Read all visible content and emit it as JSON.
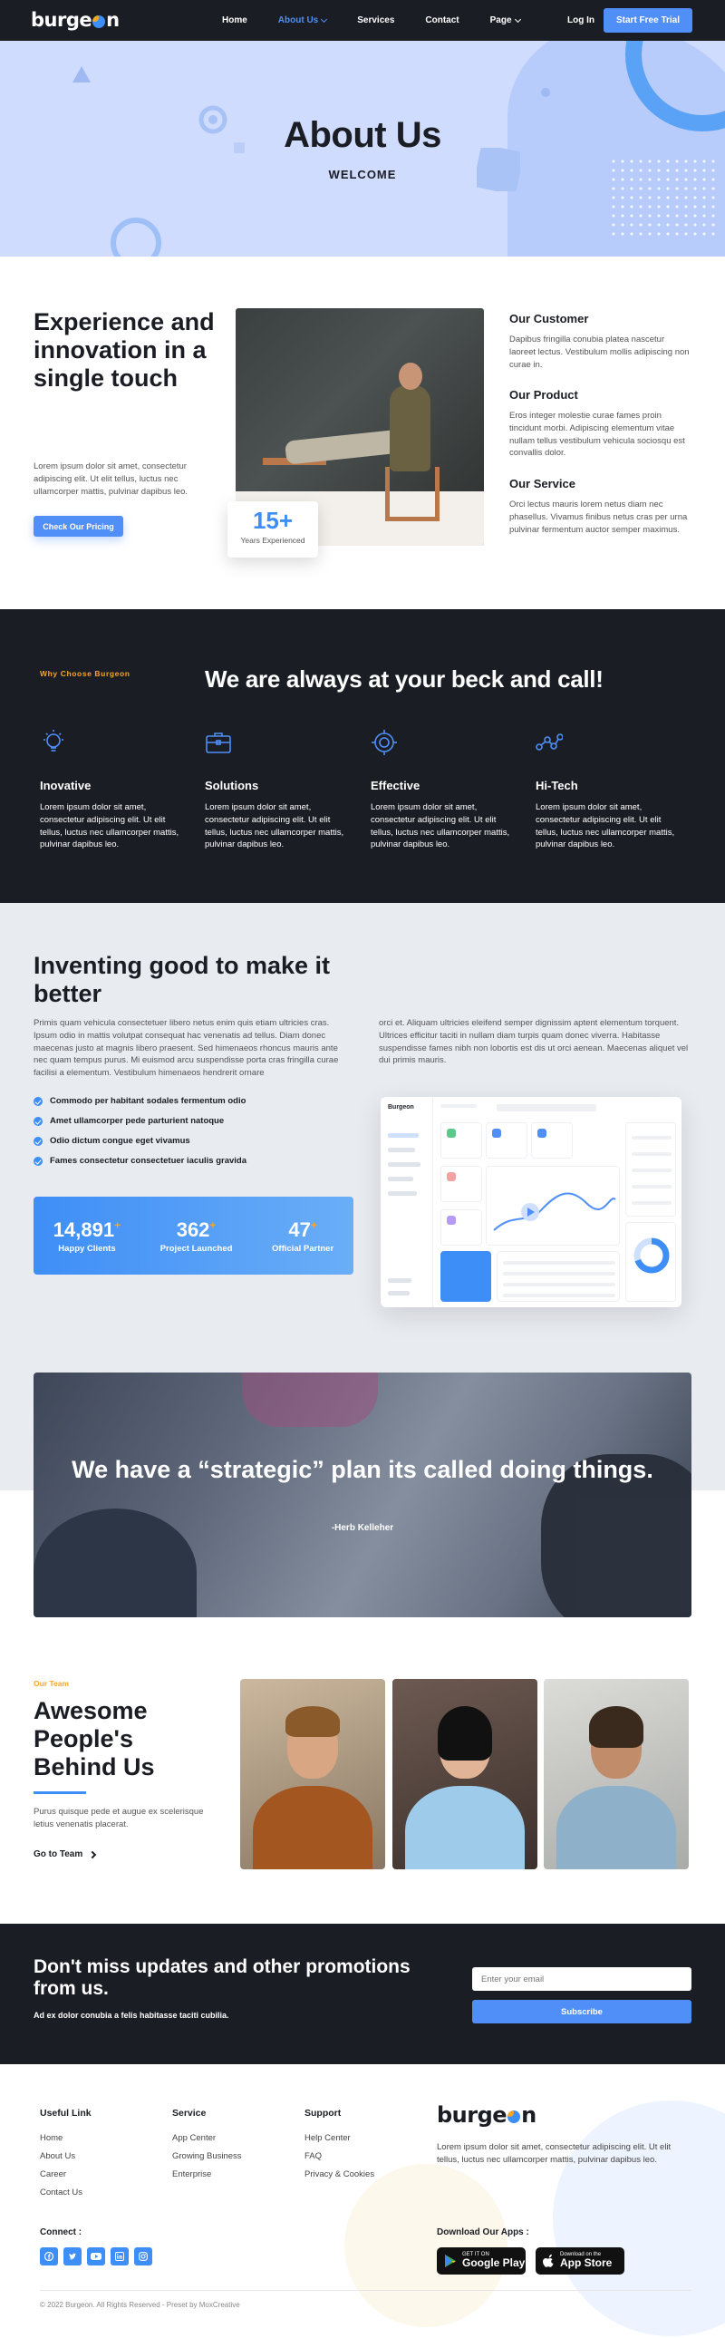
{
  "nav": {
    "brand": "burgeon",
    "links": [
      "Home",
      "About Us",
      "Services",
      "Contact",
      "Page"
    ],
    "login": "Log In",
    "cta": "Start Free Trial"
  },
  "hero": {
    "title": "About Us",
    "subtitle": "WELCOME"
  },
  "about": {
    "heading": "Experience and innovation in a single touch",
    "text": "Lorem ipsum dolor sit amet, consectetur adipiscing elit. Ut elit tellus, luctus nec ullamcorper mattis, pulvinar dapibus leo.",
    "button": "Check Our Pricing",
    "experience_number": "15+",
    "experience_label": "Years Experienced",
    "items": [
      {
        "title": "Our Customer",
        "text": "Dapibus fringilla conubia platea nascetur laoreet lectus. Vestibulum mollis adipiscing non curae in."
      },
      {
        "title": "Our Product",
        "text": "Eros integer molestie curae fames proin tincidunt morbi. Adipiscing elementum vitae nullam tellus vestibulum vehicula sociosqu est convallis dolor."
      },
      {
        "title": "Our Service",
        "text": "Orci lectus mauris lorem netus diam nec phasellus. Vivamus finibus netus cras per urna pulvinar fermentum auctor semper maximus."
      }
    ]
  },
  "why": {
    "tag": "Why Choose Burgeon",
    "heading": "We are always at your beck and call!",
    "features": [
      {
        "icon": "lightbulb-icon",
        "title": "Inovative",
        "text": "Lorem ipsum dolor sit amet, consectetur adipiscing elit. Ut elit tellus, luctus nec ullamcorper mattis, pulvinar dapibus leo."
      },
      {
        "icon": "briefcase-icon",
        "title": "Solutions",
        "text": "Lorem ipsum dolor sit amet, consectetur adipiscing elit. Ut elit tellus, luctus nec ullamcorper mattis, pulvinar dapibus leo."
      },
      {
        "icon": "gear-icon",
        "title": "Effective",
        "text": "Lorem ipsum dolor sit amet, consectetur adipiscing elit. Ut elit tellus, luctus nec ullamcorper mattis, pulvinar dapibus leo."
      },
      {
        "icon": "network-icon",
        "title": "Hi-Tech",
        "text": "Lorem ipsum dolor sit amet, consectetur adipiscing elit. Ut elit tellus, luctus nec ullamcorper mattis, pulvinar dapibus leo."
      }
    ]
  },
  "invent": {
    "heading": "Inventing good to make it better",
    "text_left": "Primis quam vehicula consectetuer libero netus enim quis etiam ultricies cras. Ipsum odio in mattis volutpat consequat hac venenatis ad tellus. Diam donec maecenas justo at magnis libero praesent. Sed himenaeos rhoncus mauris ante nec quam tempus purus. Mi euismod arcu suspendisse porta cras fringilla curae facilisi a elementum. Vestibulum himenaeos hendrerit ornare",
    "text_right": "orci et. Aliquam ultricies eleifend semper dignissim aptent elementum torquent. Ultrices efficitur taciti in nullam diam turpis quam donec viverra. Habitasse suspendisse fames nibh non lobortis est dis ut orci aenean. Maecenas aliquet vel dui primis mauris.",
    "checklist": [
      "Commodo per habitant sodales fermentum odio",
      "Amet ullamcorper pede parturient natoque",
      "Odio dictum congue eget vivamus",
      "Fames consectetur consectetuer iaculis gravida"
    ],
    "stats": [
      {
        "number": "14,891",
        "suffix": "+",
        "label": "Happy Clients"
      },
      {
        "number": "362",
        "suffix": "+",
        "label": "Project Launched"
      },
      {
        "number": "47",
        "suffix": "+",
        "label": "Official Partner"
      }
    ],
    "dashboard": {
      "brand": "Burgeon"
    }
  },
  "quote": {
    "text": "We have a “strategic” plan its called doing things.",
    "author": "-Herb Kelleher"
  },
  "team": {
    "tag": "Our Team",
    "heading": "Awesome People's Behind Us",
    "text": "Purus quisque pede et augue ex scelerisque letius venenatis placerat.",
    "link": "Go to Team"
  },
  "newsletter": {
    "heading": "Don't miss updates and other promotions from us.",
    "text": "Ad ex dolor conubia a felis habitasse taciti cubilia.",
    "placeholder": "Enter your email",
    "button": "Subscribe"
  },
  "footer": {
    "columns": [
      {
        "title": "Useful Link",
        "links": [
          "Home",
          "About Us",
          "Career",
          "Contact Us"
        ]
      },
      {
        "title": "Service",
        "links": [
          "App Center",
          "Growing Business",
          "Enterprise"
        ]
      },
      {
        "title": "Support",
        "links": [
          "Help Center",
          "FAQ",
          "Privacy & Cookies"
        ]
      }
    ],
    "brand": "burgeon",
    "description": "Lorem ipsum dolor sit amet, consectetur adipiscing elit. Ut elit tellus, luctus nec ullamcorper mattis, pulvinar dapibus leo.",
    "connect": "Connect :",
    "socials": [
      "facebook-icon",
      "twitter-icon",
      "youtube-icon",
      "linkedin-icon",
      "instagram-icon"
    ],
    "download": "Download Our Apps :",
    "stores": [
      {
        "small": "GET IT ON",
        "big": "Google Play"
      },
      {
        "small": "Download on the",
        "big": "App Store"
      }
    ],
    "copyright": "© 2022 Burgeon. All Rights Reserved - Preset by MoxCreative"
  },
  "colors": {
    "accent": "#4f8ff7",
    "dark": "#1b1d24",
    "orange": "#f5a623",
    "hero_bg": "#cfdcfd"
  }
}
